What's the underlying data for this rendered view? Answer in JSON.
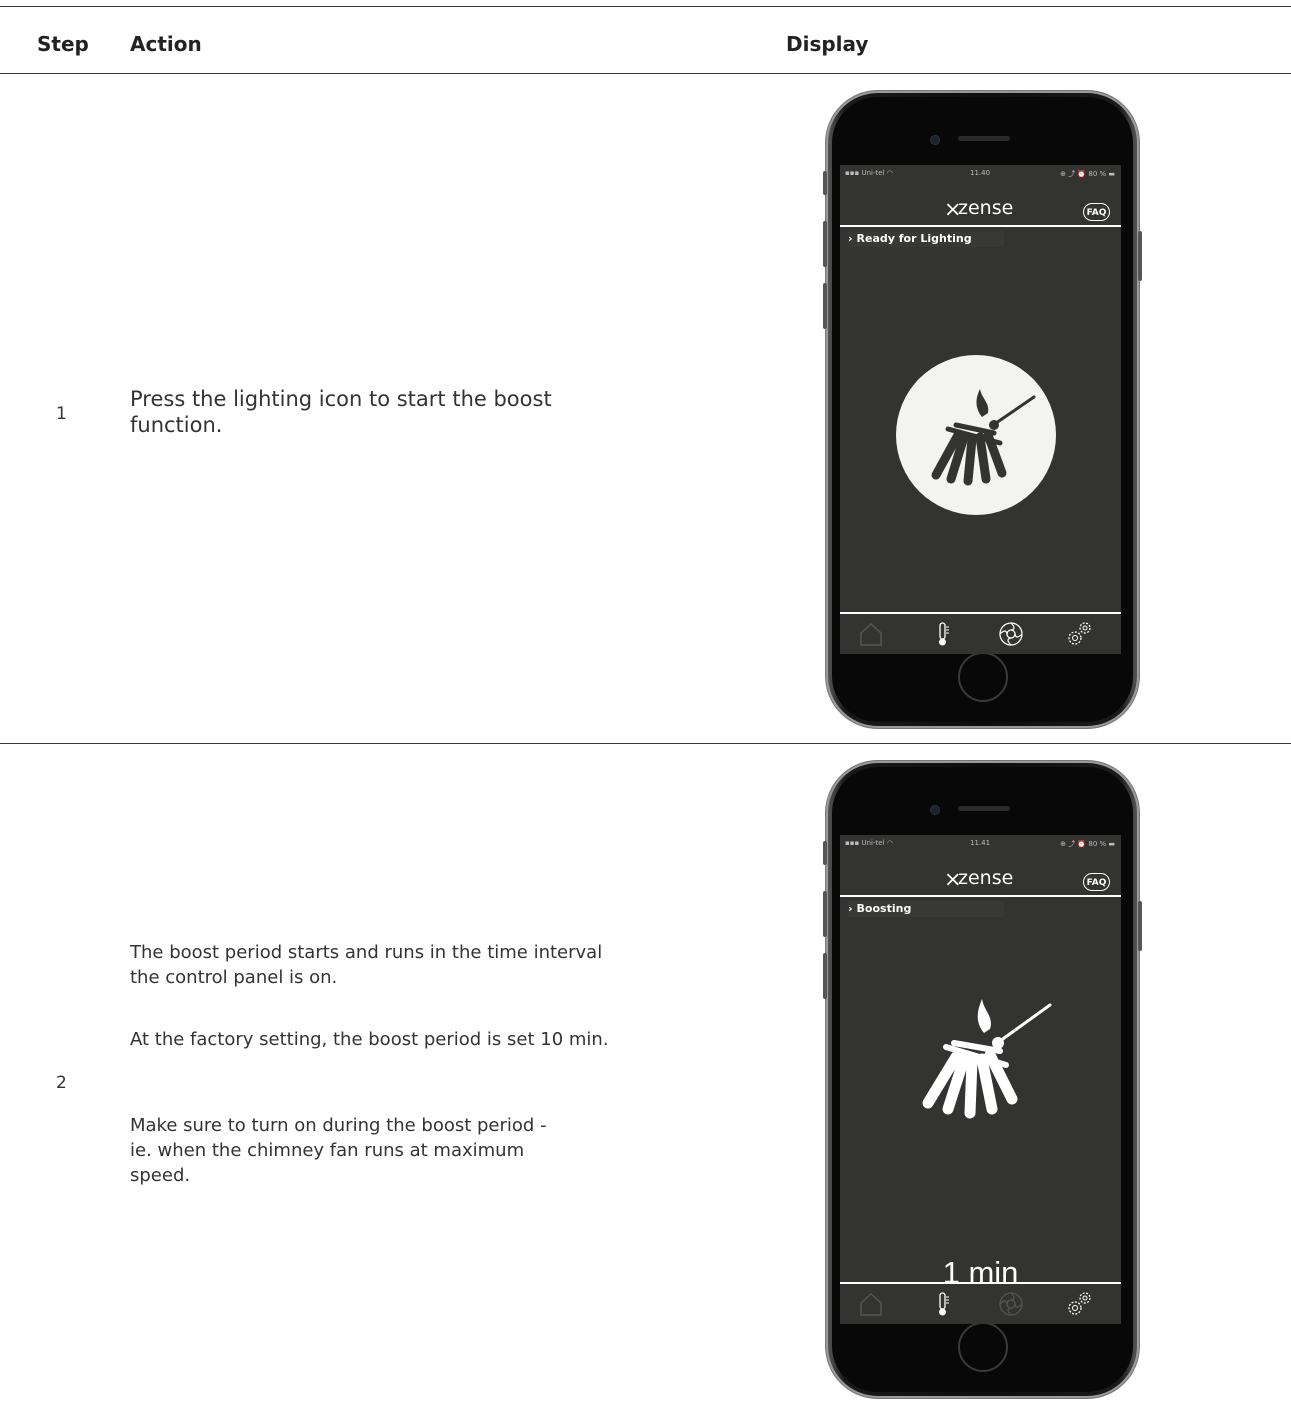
{
  "table": {
    "headers": {
      "step": "Step",
      "action": "Action",
      "display": "Display"
    }
  },
  "rows": [
    {
      "step": "1",
      "action": "Press the lighting icon to start the boost function.",
      "phone": {
        "status_bar": {
          "carrier": "Uni-tel",
          "time": "11.40",
          "battery": "80 %"
        },
        "brand": "zense",
        "faq_label": "FAQ",
        "status_message": "Ready for Lighting",
        "icons": [
          "lighting-icon",
          "home-icon",
          "thermometer-icon",
          "fan-icon",
          "settings-icon"
        ]
      }
    },
    {
      "step": "2",
      "action_paragraphs": [
        "The boost period starts and runs in the time interval the control panel is on.",
        "At the factory setting, the boost period is set 10 min.",
        "Make sure to turn on during the boost period - ie. when the chimney fan runs at maximum speed."
      ],
      "phone": {
        "status_bar": {
          "carrier": "Uni-tel",
          "time": "11.41",
          "battery": "80 %"
        },
        "brand": "zense",
        "faq_label": "FAQ",
        "status_message": "Boosting",
        "timer": "1 min",
        "icons": [
          "lighting-icon",
          "home-icon",
          "thermometer-icon",
          "fan-icon",
          "settings-icon"
        ]
      }
    }
  ]
}
